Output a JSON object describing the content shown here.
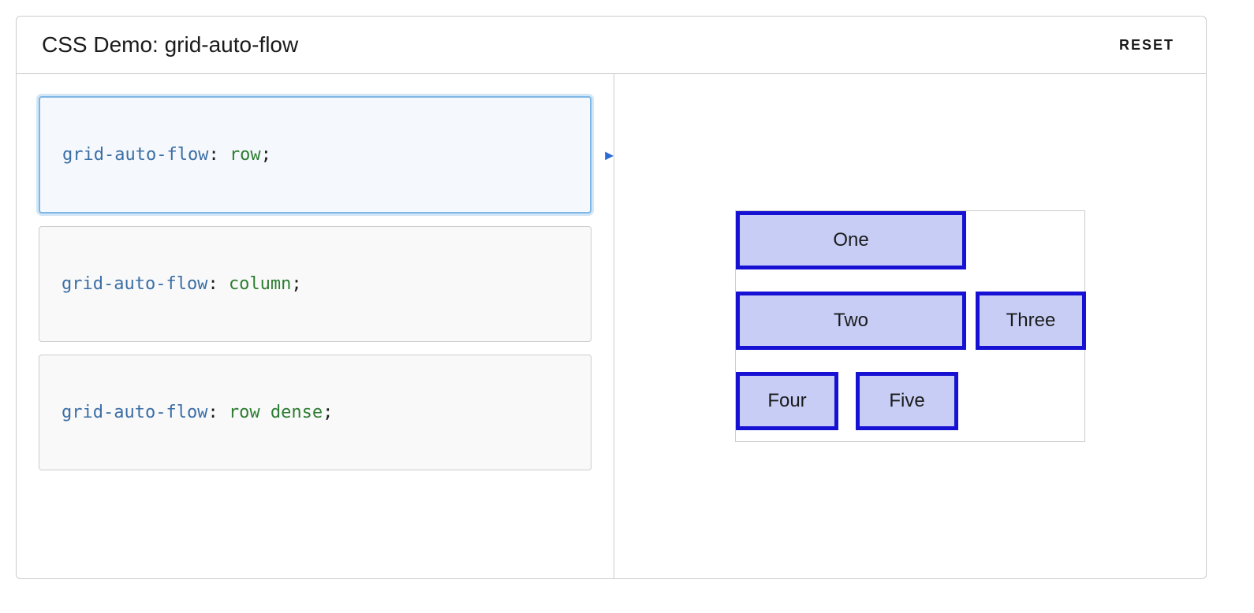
{
  "header": {
    "title": "CSS Demo: grid-auto-flow",
    "reset_label": "RESET"
  },
  "options": [
    {
      "property": "grid-auto-flow",
      "value": "row",
      "selected": true
    },
    {
      "property": "grid-auto-flow",
      "value": "column",
      "selected": false
    },
    {
      "property": "grid-auto-flow",
      "value": "row dense",
      "selected": false
    }
  ],
  "grid_items": {
    "one": "One",
    "two": "Two",
    "three": "Three",
    "four": "Four",
    "five": "Five"
  }
}
